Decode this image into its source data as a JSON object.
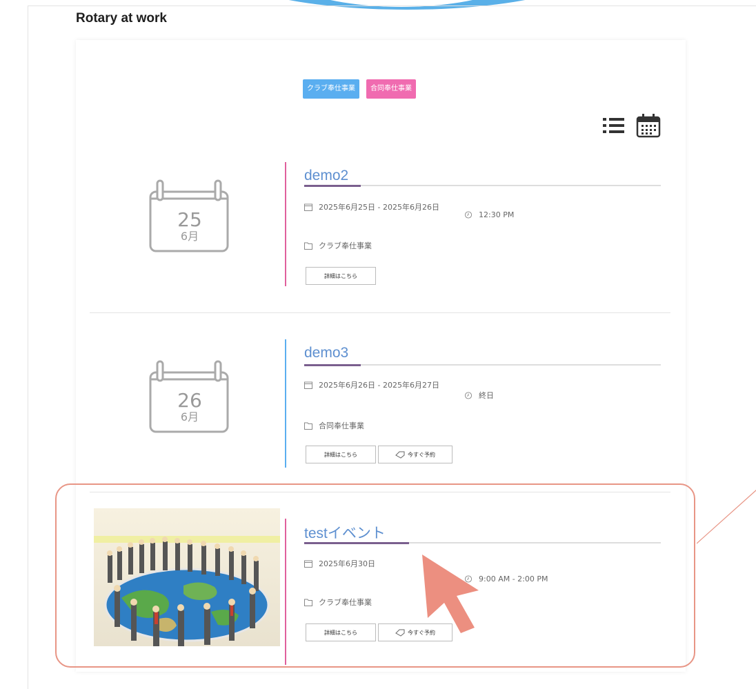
{
  "section_title": "Rotary at work",
  "filters": [
    {
      "label": "クラブ奉仕事業",
      "color": "#5aaef0"
    },
    {
      "label": "合同奉仕事業",
      "color": "#f06bb0"
    }
  ],
  "events": [
    {
      "title": "demo2",
      "date_day": "25",
      "date_month": "6月",
      "date_range": "2025年6月25日 - 2025年6月26日",
      "time": "12:30 PM",
      "category": "クラブ奉仕事業",
      "accent": "#e0609c",
      "details_label": "詳細はこちら"
    },
    {
      "title": "demo3",
      "date_day": "26",
      "date_month": "6月",
      "date_range": "2025年6月26日 - 2025年6月27日",
      "time": "終日",
      "category": "合同奉仕事業",
      "accent": "#5aaef0",
      "details_label": "詳細はこちら",
      "reserve_label": "今すぐ予約"
    },
    {
      "title": "testイベント",
      "date_range": "2025年6月30日",
      "time": "9:00 AM - 2:00 PM",
      "category": "クラブ奉仕事業",
      "accent": "#e0609c",
      "details_label": "詳細はこちら",
      "reserve_label": "今すぐ予約"
    }
  ],
  "colors": {
    "title_link": "#5d8fd0",
    "highlight_outline": "#e89585",
    "arrow": "#ec8f80"
  },
  "icons": [
    "list-view-icon",
    "calendar-view-icon",
    "calendar-small-icon",
    "clock-icon",
    "folder-icon",
    "ticket-icon"
  ]
}
